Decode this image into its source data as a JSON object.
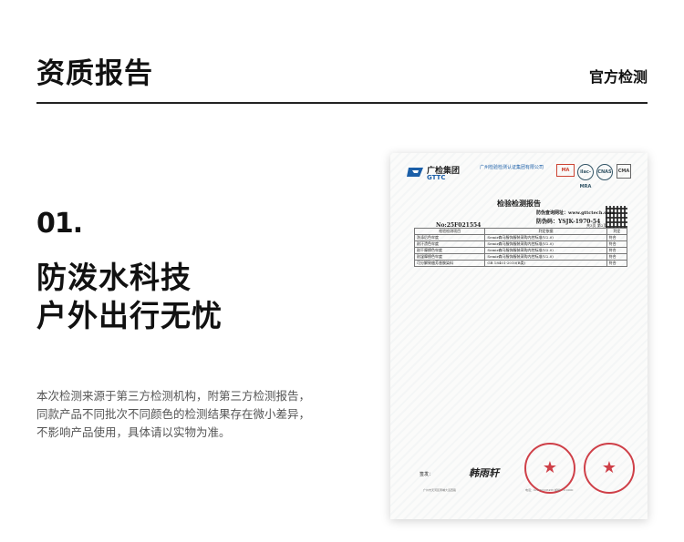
{
  "header": {
    "title": "资质报告",
    "tag": "官方检测"
  },
  "section": {
    "number": "01.",
    "headline_line1": "防泼水科技",
    "headline_line2": "户外出行无忧",
    "description_lines": [
      "本次检测来源于第三方检测机构，附第三方检测报告，",
      "同款产品不同批次不同颜色的检测结果存在微小差异，",
      "不影响产品使用，具体请以实物为准。"
    ]
  },
  "report": {
    "lab_name_cn": "广检集团",
    "lab_name_en": "GTTC",
    "org_name": "广州检验检测认证集团有限公司",
    "cert_marks": [
      "MA",
      "ilac-MRA",
      "CNAS",
      "CMA"
    ],
    "doc_title": "检验检测报告",
    "query_site": "防伪查询网址：www.gttctech.com",
    "anti_fake_code": "防伪码：YSJK-1970-54",
    "report_no": "No:25F021554",
    "page": "共3页 第2页",
    "table_headers": [
      "检验检测项目",
      "判定依据",
      "判定"
    ],
    "table_rows": [
      [
        "洗涤后色牢度",
        "Semir森马服饰服装采购内控标准(V2.0)",
        "符合"
      ],
      [
        "耐汗渍色牢度",
        "Semir森马服饰服装采购内控标准(V2.0)",
        "符合"
      ],
      [
        "耐干摩擦色牢度",
        "Semir森马服饰服装采购内控标准(V2.0)",
        "符合"
      ],
      [
        "耐湿摩擦色牢度",
        "Semir森马服饰服装采购内控标准(V2.0)",
        "符合"
      ],
      [
        "可分解致癌芳香胺染料",
        "GB 18401-2010(B类)",
        "符合"
      ]
    ],
    "signature_label": "签发：",
    "signature": "韩雨轩",
    "stamp_text": "检验检测专用章",
    "footer_left": "广州市天河区黄埔大道西路",
    "footer_right": "电话：020-32206456  邮编：510000"
  }
}
